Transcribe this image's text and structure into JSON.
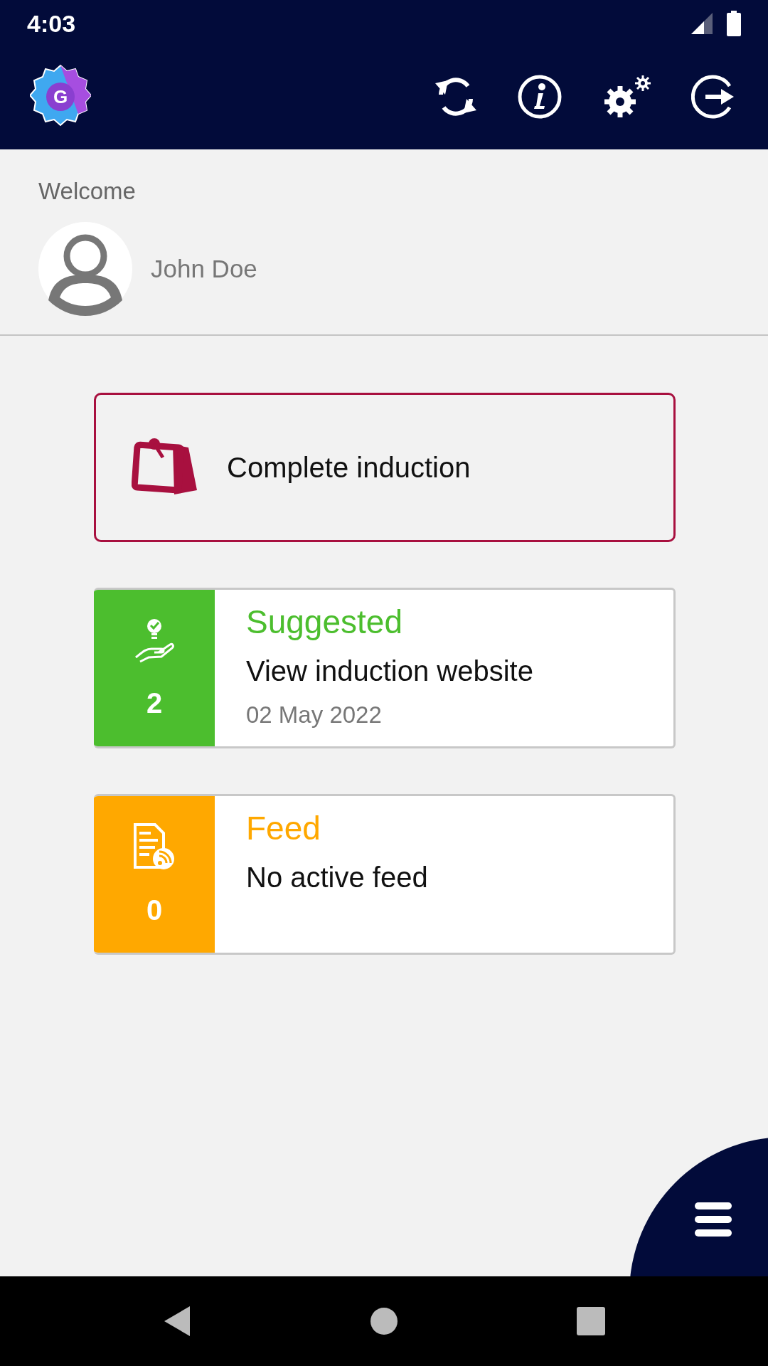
{
  "status_bar": {
    "time": "4:03"
  },
  "app_bar": {
    "logo_letter": "G"
  },
  "welcome": {
    "label": "Welcome",
    "user_name": "John Doe"
  },
  "action": {
    "label": "Complete induction"
  },
  "cards": [
    {
      "kind": "suggested",
      "color": "#4cbe2e",
      "count": "2",
      "title": "Suggested",
      "text": "View induction website",
      "date": "02 May 2022"
    },
    {
      "kind": "feed",
      "color": "#ffa800",
      "count": "0",
      "title": "Feed",
      "text": "No active feed"
    }
  ]
}
